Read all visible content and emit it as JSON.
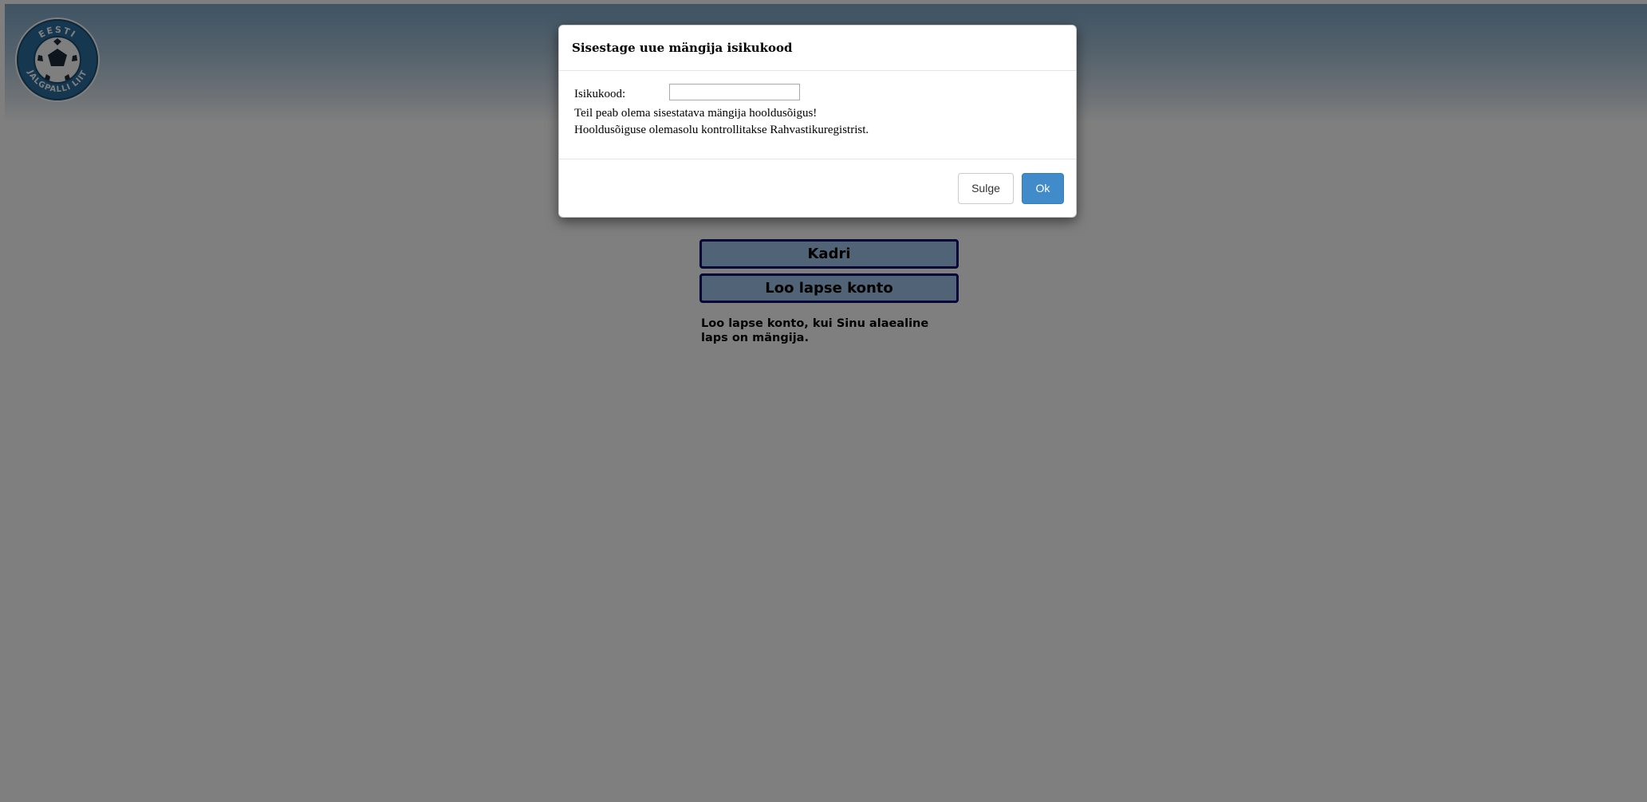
{
  "app": {
    "logo_text_top": "EESTI",
    "logo_text_bottom": "JALGPALLI LIIT",
    "buttons": {
      "profile_label": "Kadri",
      "create_child_label": "Loo lapse konto"
    },
    "info_text": "Loo lapse konto, kui Sinu alaealine laps on mängija."
  },
  "modal": {
    "title": "Sisestage uue mängija isikukood",
    "field_label": "Isikukood:",
    "field_value": "",
    "field_placeholder": "",
    "message_line1": "Teil peab olema sisestatava mängija hooldusõigus!",
    "message_line2": "Hooldusõiguse olemasolu kontrollitakse Rahvastikuregistrist.",
    "close_label": "Sulge",
    "ok_label": "Ok"
  },
  "colors": {
    "header_gradient_top": "#7fa8c9",
    "button_fill": "#a2c7ec",
    "button_border": "#0d0d6e",
    "ok_button": "#428bca",
    "backdrop": "rgba(0,0,0,0.5)"
  }
}
